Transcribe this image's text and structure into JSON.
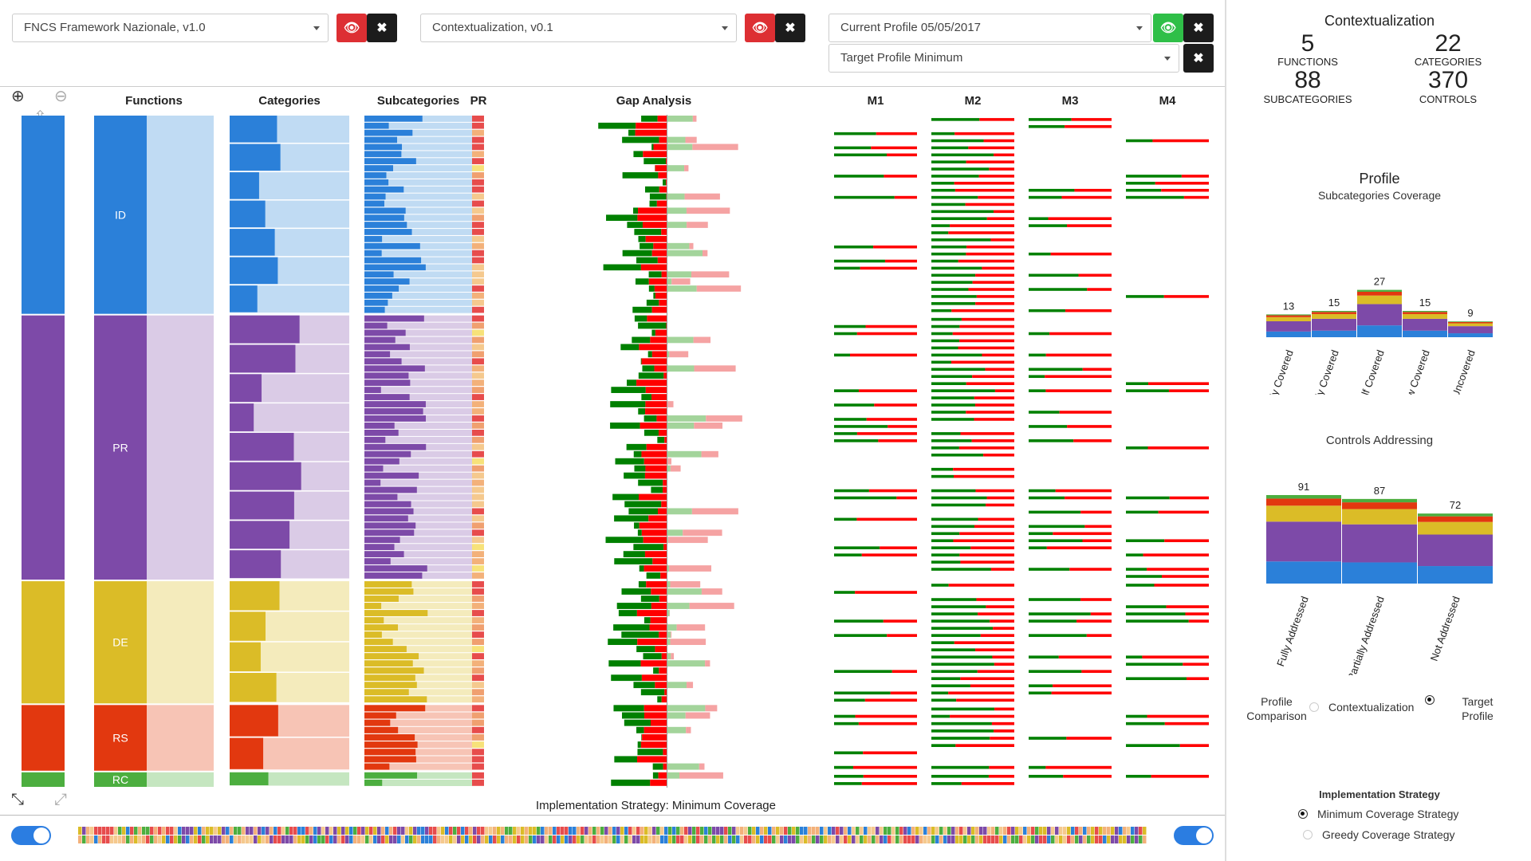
{
  "selectors": {
    "framework": "FNCS Framework Nazionale, v1.0",
    "contextualization": "Contextualization, v0.1",
    "current_profile": "Current Profile 05/05/2017",
    "target_profile": "Target Profile Minimum"
  },
  "columns": {
    "functions": "Functions",
    "categories": "Categories",
    "subcategories": "Subcategories",
    "pr": "PR",
    "gap": "Gap Analysis",
    "m1": "M1",
    "m2": "M2",
    "m3": "M3",
    "m4": "M4"
  },
  "functions": [
    {
      "code": "ID",
      "color": "#2b80d9",
      "light": "#c0dbf3",
      "share": 0.297
    },
    {
      "code": "PR",
      "color": "#7d4aa8",
      "light": "#dacbe6",
      "share": 0.395
    },
    {
      "code": "DE",
      "color": "#dbbc27",
      "light": "#f4ebbc",
      "share": 0.184
    },
    {
      "code": "RS",
      "color": "#e2380f",
      "light": "#f7c4b5",
      "share": 0.1
    },
    {
      "code": "RC",
      "color": "#4cae3f",
      "light": "#c5e6c0",
      "share": 0.024
    }
  ],
  "strategy_title": "Implementation Strategy: Minimum Coverage",
  "side": {
    "title": "Contextualization",
    "functions_count": "5",
    "functions_label": "FUNCTIONS",
    "categories_count": "22",
    "categories_label": "CATEGORIES",
    "subcategories_count": "88",
    "subcategories_label": "SUBCATEGORIES",
    "controls_count": "370",
    "controls_label": "CONTROLS",
    "profile_title": "Profile",
    "profile_subtitle": "Subcategories Coverage",
    "controls_title": "Controls Addressing",
    "profile_comparison": "Profile Comparison",
    "opt_contextualization": "Contextualization",
    "opt_target": "Target Profile",
    "impl_title": "Implementation Strategy",
    "opt_min": "Minimum Coverage Strategy",
    "opt_greedy": "Greedy Coverage Strategy"
  },
  "chart_data": [
    {
      "type": "bar",
      "title": "Profile",
      "subtitle": "Subcategories Coverage",
      "categories": [
        "Fully Covered",
        "Mostly Covered",
        "Half Covered",
        "Low Covered",
        "Uncovered"
      ],
      "values": [
        13,
        15,
        27,
        15,
        9
      ]
    },
    {
      "type": "bar",
      "title": "Controls Addressing",
      "categories": [
        "Fully Addressed",
        "Partially Addressed",
        "Not Addressed"
      ],
      "values": [
        91,
        87,
        72
      ]
    }
  ],
  "colors": {
    "gap_green": "#008000",
    "gap_red": "#ff0000",
    "gap_light_green": "#a3d49b",
    "gap_light_red": "#f5a3a3"
  }
}
